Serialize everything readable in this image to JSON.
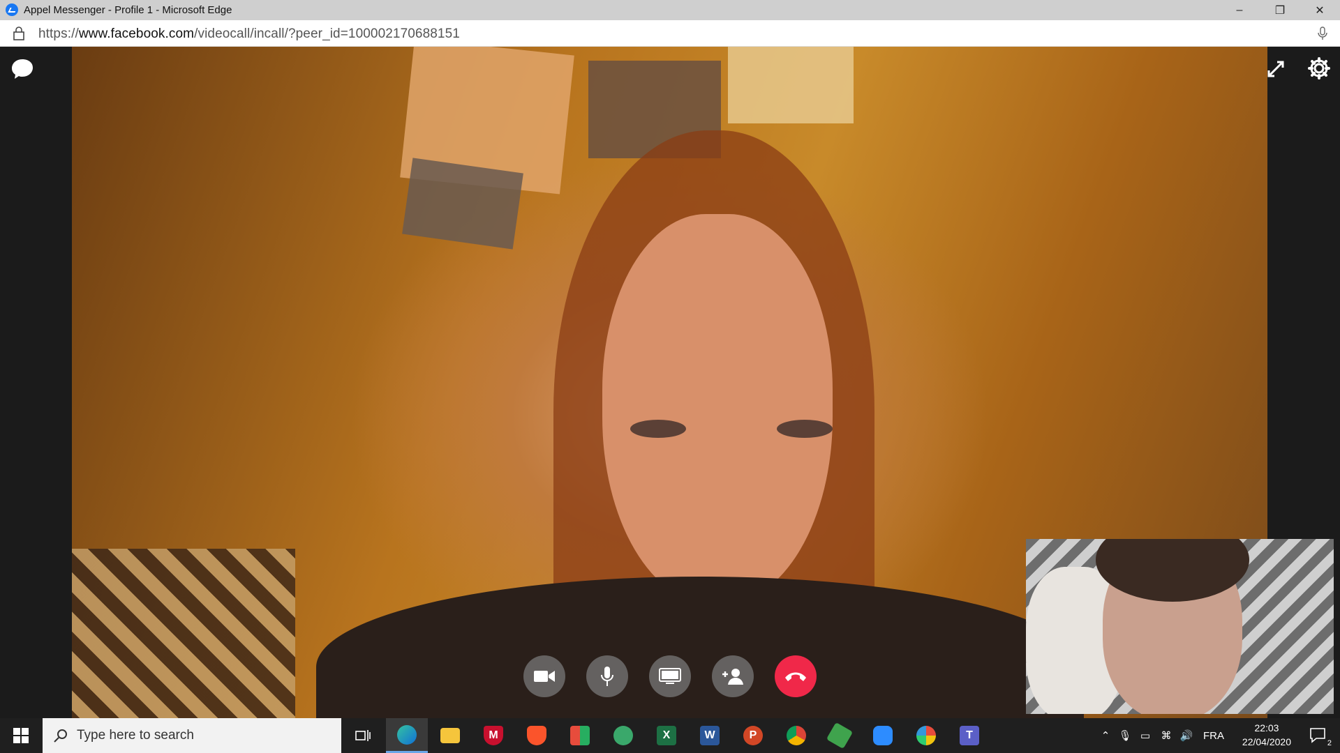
{
  "window": {
    "title": "Appel Messenger - Profile 1 - Microsoft Edge",
    "controls": [
      "minimize",
      "restore",
      "close"
    ]
  },
  "address_bar": {
    "url_prefix": "https://",
    "url_host": "www.facebook.com",
    "url_path": "/videocall/incall/?peer_id=100002170688151"
  },
  "call": {
    "left_rail": {
      "icon": "chat-bubble-icon"
    },
    "right_rail": {
      "icons": [
        "fullscreen-icon",
        "gear-icon"
      ]
    },
    "controls": [
      "camera-icon",
      "microphone-icon",
      "screen-share-icon",
      "add-person-icon",
      "end-call-icon"
    ],
    "end_call_color": "#f02849"
  },
  "taskbar": {
    "search_placeholder": "Type here to search",
    "apps": [
      "task-view",
      "edge",
      "file-explorer",
      "mcafee",
      "brave",
      "office-store",
      "atom",
      "excel",
      "word",
      "powerpoint",
      "chrome",
      "cube-app",
      "zoom",
      "picasa",
      "teams"
    ],
    "tray": {
      "language": "FRA",
      "time": "22:03",
      "date": "22/04/2020",
      "notification_count": "2"
    }
  }
}
